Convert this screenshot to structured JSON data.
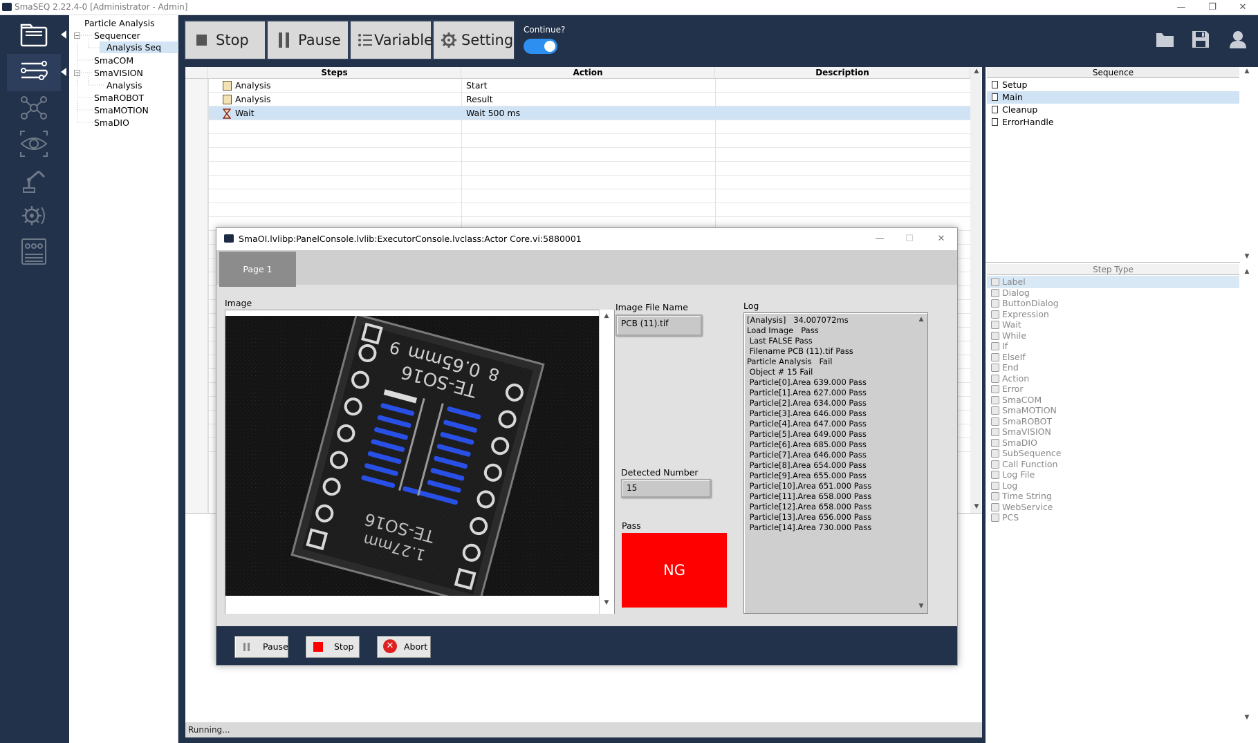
{
  "app": {
    "window_title": "SmaSEQ 2.22.4-0 [Administrator - Admin]",
    "window_controls": [
      "—",
      "❐",
      "✕"
    ]
  },
  "left_sidebar": {
    "icons": [
      "document-folder-icon",
      "sequencer-icon",
      "network-icon",
      "vision-icon",
      "robot-icon",
      "motion-gear-icon",
      "dio-board-icon"
    ]
  },
  "tree": {
    "items": [
      {
        "label": "Particle Analysis",
        "level": 0,
        "expander": ""
      },
      {
        "label": "Sequencer",
        "level": 1,
        "expander": "−"
      },
      {
        "label": "Analysis Seq",
        "level": 2,
        "expander": "",
        "selected": true
      },
      {
        "label": "SmaCOM",
        "level": 1,
        "expander": ""
      },
      {
        "label": "SmaVISION",
        "level": 1,
        "expander": "−"
      },
      {
        "label": "Analysis",
        "level": 2,
        "expander": ""
      },
      {
        "label": "SmaROBOT",
        "level": 1,
        "expander": ""
      },
      {
        "label": "SmaMOTION",
        "level": 1,
        "expander": ""
      },
      {
        "label": "SmaDIO",
        "level": 1,
        "expander": ""
      }
    ]
  },
  "toolbar": {
    "stop_label": "Stop",
    "pause_label": "Pause",
    "variable_label": "Variable",
    "setting_label": "Setting",
    "continue_label": "Continue?",
    "continue_on": true
  },
  "steps_table": {
    "headers": {
      "steps": "Steps",
      "action": "Action",
      "description": "Description"
    },
    "rows": [
      {
        "index": "0",
        "step": "Analysis",
        "action": "Start",
        "description": "",
        "icon": "list-icon"
      },
      {
        "index": "1",
        "step": "Analysis",
        "action": "Result",
        "description": "",
        "icon": "list-icon"
      },
      {
        "index": "2",
        "step": "Wait",
        "action": "Wait 500 ms",
        "description": "",
        "icon": "hourglass-icon",
        "selected": true
      }
    ]
  },
  "sequence_panel": {
    "header": "Sequence",
    "items": [
      {
        "label": "Setup"
      },
      {
        "label": "Main",
        "selected": true
      },
      {
        "label": "Cleanup"
      },
      {
        "label": "ErrorHandle"
      }
    ]
  },
  "step_type_panel": {
    "header": "Step Type",
    "items": [
      "Label",
      "Dialog",
      "ButtonDialog",
      "Expression",
      "Wait",
      "While",
      "If",
      "ElseIf",
      "End",
      "Action",
      "Error",
      "SmaCOM",
      "SmaMOTION",
      "SmaROBOT",
      "SmaVISION",
      "SmaDIO",
      "SubSequence",
      "Call Function",
      "Log File",
      "Log",
      "Time String",
      "WebService",
      "PCS"
    ]
  },
  "status": {
    "text": "Running..."
  },
  "dialog": {
    "title": "SmaOI.lvlibp:PanelConsole.lvlib:ExecutorConsole.lvclass:Actor Core.vi:5880001",
    "tab": "Page 1",
    "image_label": "Image",
    "image_file_name_label": "Image File Name",
    "image_file_name": "PCB (11).tif",
    "detected_number_label": "Detected Number",
    "detected_number": "15",
    "pass_label": "Pass",
    "pass_value": "NG",
    "pass_color": "#ff0000",
    "log_label": "Log",
    "log_lines": [
      "[Analysis]   34.007072ms",
      "Load Image   Pass",
      " Last FALSE Pass",
      " Filename PCB (11).tif Pass",
      "Particle Analysis   Fail",
      " Object # 15 Fail",
      " Particle[0].Area 639.000 Pass",
      " Particle[1].Area 627.000 Pass",
      " Particle[2].Area 634.000 Pass",
      " Particle[3].Area 646.000 Pass",
      " Particle[4].Area 647.000 Pass",
      " Particle[5].Area 649.000 Pass",
      " Particle[6].Area 685.000 Pass",
      " Particle[7].Area 646.000 Pass",
      " Particle[8].Area 654.000 Pass",
      " Particle[9].Area 655.000 Pass",
      " Particle[10].Area 651.000 Pass",
      " Particle[11].Area 658.000 Pass",
      " Particle[12].Area 658.000 Pass",
      " Particle[13].Area 656.000 Pass",
      " Particle[14].Area 730.000 Pass"
    ],
    "buttons": {
      "pause": "Pause",
      "stop": "Stop",
      "abort": "Abort"
    },
    "pcb_texts": {
      "top": "TE-SO16",
      "top_dim": "0.65mm",
      "pin_a": "9",
      "pin_b": "8",
      "bottom": "TE-SO16",
      "bottom_dim": "1.27mm"
    }
  },
  "colors": {
    "sidebar_bg": "#22324a",
    "selection": "#cfe3f5",
    "accent_toggle": "#2d8ff0",
    "particle_blue": "#2950e6"
  }
}
